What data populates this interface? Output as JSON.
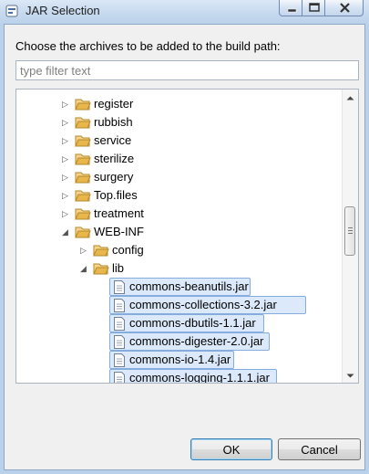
{
  "window": {
    "title": "JAR Selection",
    "title_icon": "eclipse-dialog-icon",
    "controls": [
      "minimize-icon",
      "maximize-icon",
      "close-icon"
    ]
  },
  "dialog": {
    "prompt": "Choose the archives to be added to the build path:",
    "filter_placeholder": "type filter text",
    "filter_value": ""
  },
  "tree": {
    "folders": [
      {
        "label": "register",
        "expanded": false
      },
      {
        "label": "rubbish",
        "expanded": false
      },
      {
        "label": "service",
        "expanded": false
      },
      {
        "label": "sterilize",
        "expanded": false
      },
      {
        "label": "surgery",
        "expanded": false
      },
      {
        "label": "Top.files",
        "expanded": false
      },
      {
        "label": "treatment",
        "expanded": false
      },
      {
        "label": "WEB-INF",
        "expanded": true
      },
      {
        "label": "config",
        "expanded": false
      },
      {
        "label": "lib",
        "expanded": true
      }
    ],
    "jars": [
      {
        "label": "commons-beanutils.jar",
        "selected": true
      },
      {
        "label": "commons-collections-3.2.jar",
        "selected": true
      },
      {
        "label": "commons-dbutils-1.1.jar",
        "selected": true
      },
      {
        "label": "commons-digester-2.0.jar",
        "selected": true
      },
      {
        "label": "commons-io-1.4.jar",
        "selected": true
      },
      {
        "label": "commons-logging-1.1.1.jar",
        "selected": true
      }
    ],
    "icons": {
      "folder": "folder-icon",
      "jar": "jar-file-icon",
      "collapsed": "expand-arrow-icon",
      "expanded": "collapse-arrow-icon"
    }
  },
  "buttons": {
    "ok": "OK",
    "cancel": "Cancel"
  },
  "colors": {
    "selection_fill": "#dbe9fb",
    "selection_border": "#84acdd",
    "folder": "#e8b64a"
  }
}
